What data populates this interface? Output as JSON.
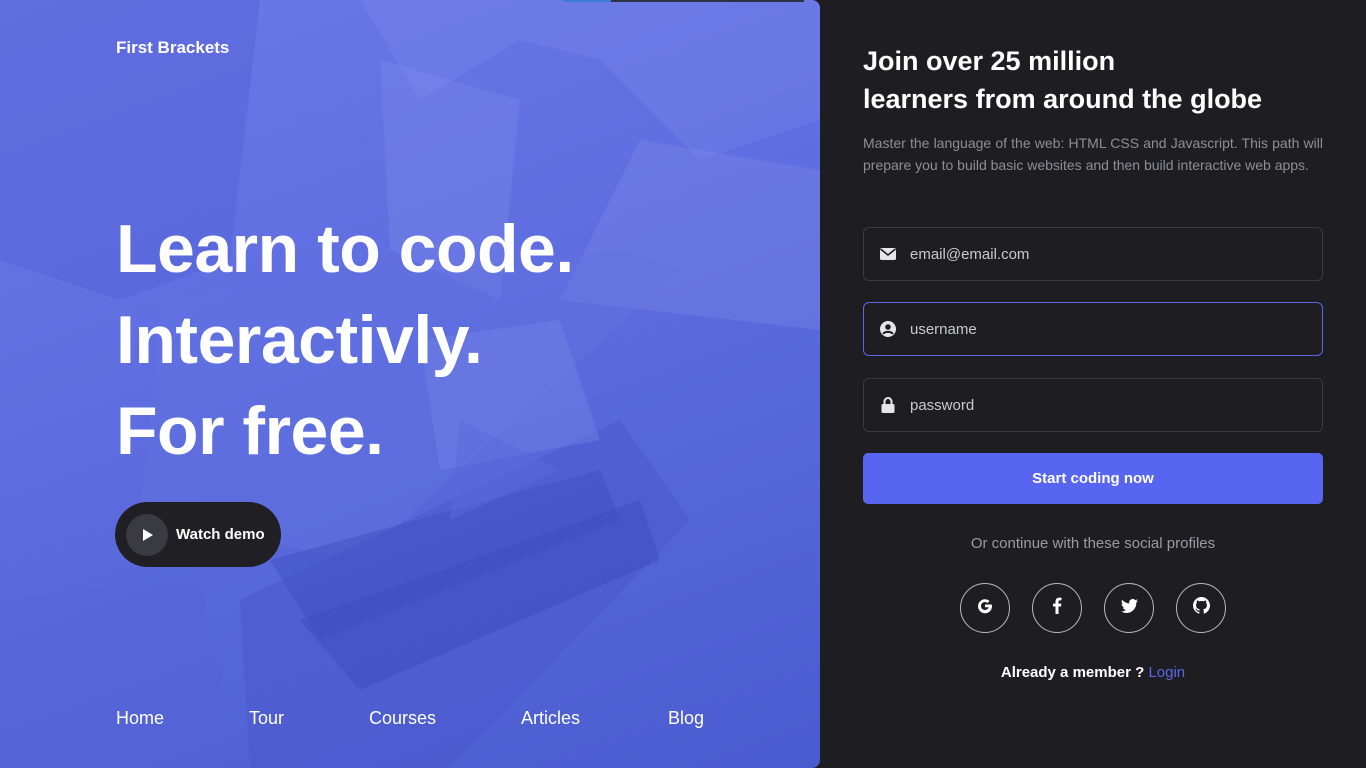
{
  "brand": "First Brackets",
  "hero": {
    "line1": "Learn to code.",
    "line2": "Interactivly.",
    "line3": "For free.",
    "demo_label": "Watch demo"
  },
  "nav": [
    "Home",
    "Tour",
    "Courses",
    "Articles",
    "Blog"
  ],
  "signup": {
    "title_line1": "Join over 25 million",
    "title_line2": "learners from around the globe",
    "description": "Master the language of the web: HTML CSS and Javascript. This path will prepare you to build basic websites and then build interactive web apps.",
    "email_placeholder": "email@email.com",
    "username_placeholder": "username",
    "password_placeholder": "password",
    "submit_label": "Start coding now",
    "social_text": "Or continue with these social profiles",
    "member_text": "Already a member ?",
    "login_label": "Login"
  },
  "icons": [
    "envelope-icon",
    "user-circle-icon",
    "lock-icon",
    "play-icon",
    "google-icon",
    "facebook-icon",
    "twitter-icon",
    "github-icon"
  ],
  "colors": {
    "hero_overlay": "#5f6ee0",
    "panel_bg": "#1e1e22",
    "accent": "#5765f0",
    "demo_button": "#1f1f24"
  }
}
